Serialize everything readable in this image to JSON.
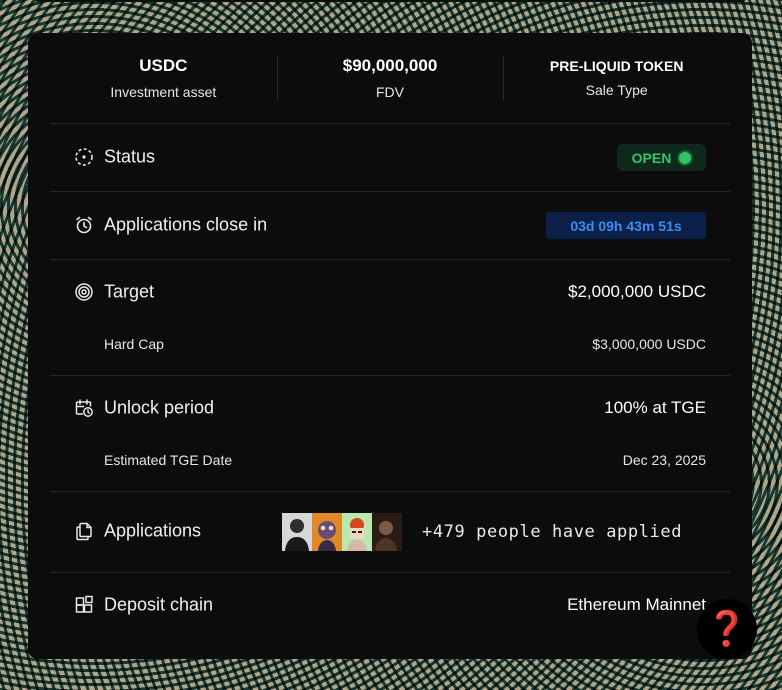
{
  "stats": [
    {
      "value": "USDC",
      "label": "Investment asset"
    },
    {
      "value": "$90,000,000",
      "label": "FDV"
    },
    {
      "value": "PRE-LIQUID TOKEN",
      "label": "Sale Type"
    }
  ],
  "status": {
    "label": "Status",
    "badge": "OPEN",
    "badge_color": "#34c56e",
    "icon": "status-dashed-circle-icon"
  },
  "applications_close": {
    "label": "Applications close in",
    "countdown": "03d 09h 43m 51s",
    "countdown_color": "#3b8df5",
    "icon": "alarm-clock-icon"
  },
  "target": {
    "label": "Target",
    "value": "$2,000,000 USDC",
    "icon": "target-icon",
    "hard_cap_label": "Hard Cap",
    "hard_cap_value": "$3,000,000 USDC"
  },
  "unlock": {
    "label": "Unlock period",
    "value": "100% at TGE",
    "icon": "calendar-clock-icon",
    "tge_label": "Estimated TGE Date",
    "tge_value": "Dec 23, 2025"
  },
  "applications": {
    "label": "Applications",
    "applied_text": "+479 people have applied",
    "icon": "documents-icon",
    "avatars": [
      "avatar-1",
      "avatar-2",
      "avatar-3",
      "avatar-4"
    ]
  },
  "deposit_chain": {
    "label": "Deposit chain",
    "value": "Ethereum Mainnet",
    "icon": "blocks-icon"
  },
  "help_button": {
    "glyph": "❓",
    "color": "#e22222"
  }
}
